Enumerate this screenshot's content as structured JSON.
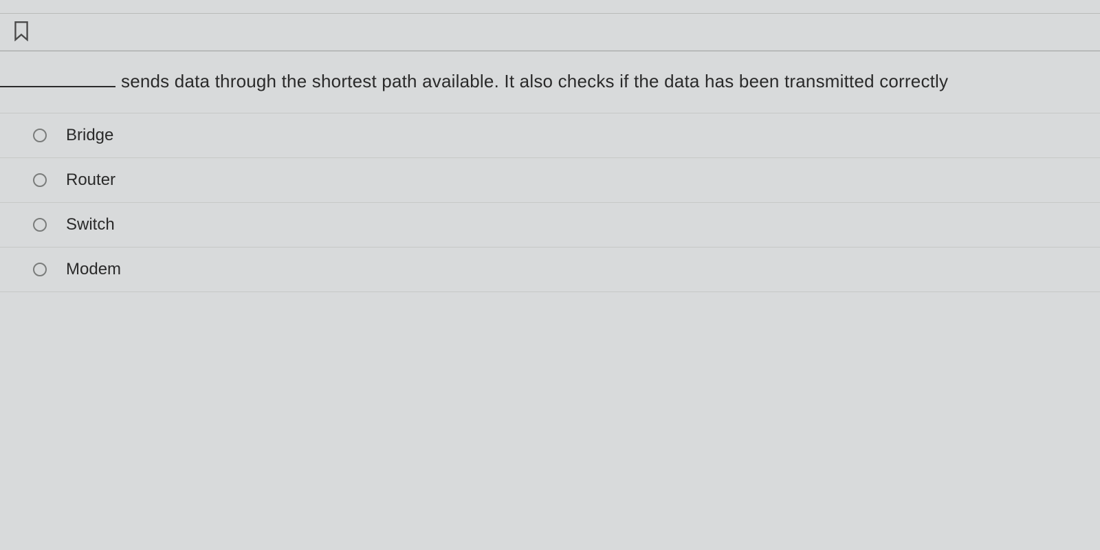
{
  "question": {
    "text": "sends data through the shortest path available. It also checks if the data has been transmitted correctly"
  },
  "options": [
    {
      "label": "Bridge"
    },
    {
      "label": "Router"
    },
    {
      "label": "Switch"
    },
    {
      "label": "Modem"
    }
  ]
}
